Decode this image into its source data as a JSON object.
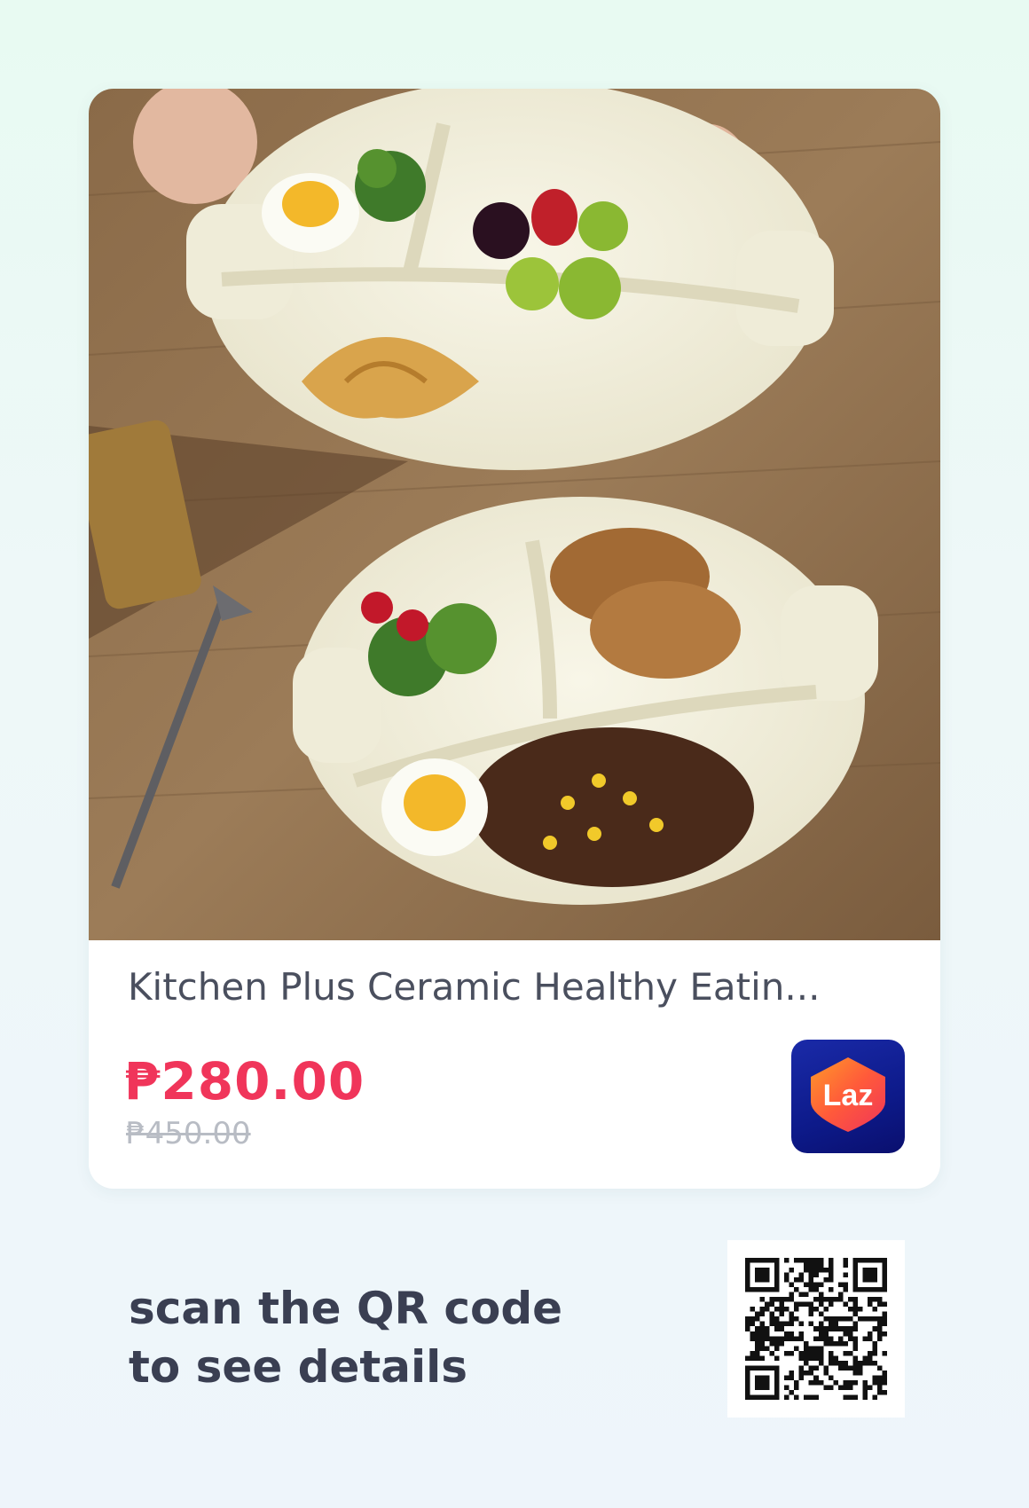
{
  "product": {
    "title": "Kitchen Plus Ceramic Healthy Eatin...",
    "price": "₱280.00",
    "original_price": "₱450.00",
    "image_icon": "divided-plate-meal-photo"
  },
  "store": {
    "logo_text": "Laz",
    "logo_icon": "lazada-heart-logo",
    "brand_colors": [
      "#ff7a2a",
      "#f0355a",
      "#1a2aa8"
    ]
  },
  "cta": {
    "line1": "scan the QR code",
    "line2": "to see details"
  },
  "qr": {
    "icon": "qr-code-icon"
  },
  "colors": {
    "price": "#f0355a",
    "old_price": "#b8bcc4",
    "title": "#4a4f5e",
    "cta": "#3a3f52"
  }
}
